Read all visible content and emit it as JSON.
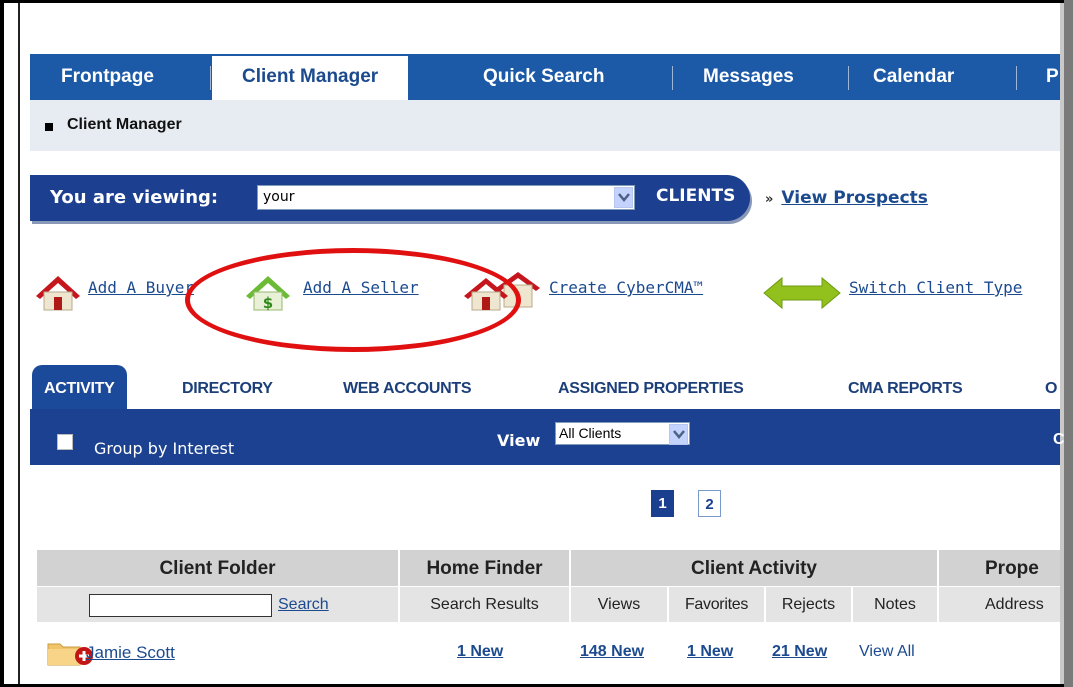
{
  "nav": {
    "tabs": [
      "Frontpage",
      "Client Manager",
      "Quick Search",
      "Messages",
      "Calendar",
      "P"
    ]
  },
  "breadcrumb": "Client Manager",
  "viewing": {
    "label": "You are viewing:",
    "selected": "your",
    "suffix": "CLIENTS",
    "prospects_link": "View Prospects",
    "prospects_prefix": "»"
  },
  "actions": {
    "add_buyer": "Add A Buyer",
    "add_seller": "Add A Seller",
    "create_cma": "Create CyberCMA™",
    "switch_type": "Switch Client Type"
  },
  "tabs": [
    "ACTIVITY",
    "DIRECTORY",
    "WEB ACCOUNTS",
    "ASSIGNED PROPERTIES",
    "CMA REPORTS",
    "O"
  ],
  "filter": {
    "group_label": "Group by Interest",
    "view_label": "View",
    "view_selected": "All Clients",
    "trailing": "C"
  },
  "pager": {
    "pages": [
      "1",
      "2"
    ],
    "current": "1"
  },
  "table": {
    "groups": [
      "Client Folder",
      "Home Finder",
      "Client Activity",
      "Prope"
    ],
    "subheaders": {
      "search_button": "Search",
      "search_results": "Search Results",
      "views": "Views",
      "favorites": "Favorites",
      "rejects": "Rejects",
      "notes": "Notes",
      "address": "Address"
    },
    "rows": [
      {
        "name": "Jamie Scott",
        "search_results": "1 New",
        "views": "148 New",
        "favorites": "1 New",
        "rejects": "21 New",
        "notes": "View All"
      }
    ]
  },
  "colors": {
    "nav_blue": "#1c5aa8",
    "dark_blue": "#1b4190",
    "link_blue": "#1c4a8f",
    "highlight_red": "#e01010"
  }
}
